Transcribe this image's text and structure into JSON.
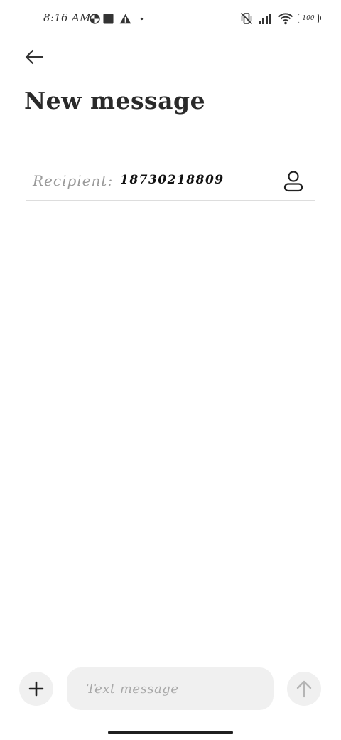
{
  "status_bar": {
    "time": "8:16 AM",
    "battery": "100",
    "left_icons": [
      "data-saver-icon",
      "square-notification-icon",
      "warning-icon",
      "dot-icon"
    ],
    "right_icons": [
      "vibrate-off-icon",
      "signal-icon",
      "wifi-icon",
      "battery-icon"
    ]
  },
  "header": {
    "back_icon": "arrow-left-icon",
    "title": "New message"
  },
  "recipient": {
    "label": "Recipient:",
    "value": "18730218809",
    "contact_icon": "person-icon"
  },
  "compose": {
    "add_icon": "plus-icon",
    "placeholder": "Text message",
    "value": "",
    "send_icon": "arrow-up-icon"
  },
  "colors": {
    "background": "#ffffff",
    "surface": "#f0f0f0",
    "text_primary": "#222222",
    "text_secondary": "#9a9a9a",
    "divider": "#dddddd"
  }
}
